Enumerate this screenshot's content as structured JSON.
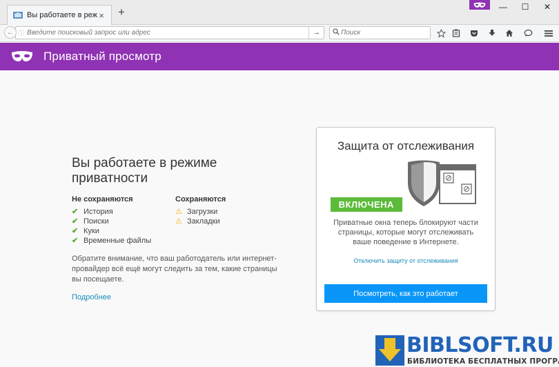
{
  "tab": {
    "title": "Вы работаете в режиме ...",
    "close": "×"
  },
  "newtab": "+",
  "window": {
    "minimize": "—",
    "maximize": "☐",
    "close": "✕"
  },
  "nav": {
    "url_placeholder": "Введите поисковый запрос или адрес",
    "go": "→",
    "search_placeholder": "Поиск"
  },
  "header": {
    "title": "Приватный просмотр"
  },
  "private": {
    "heading": "Вы работаете в режиме приватности",
    "not_saved": {
      "title": "Не сохраняются",
      "items": [
        "История",
        "Поиски",
        "Куки",
        "Временные файлы"
      ]
    },
    "saved": {
      "title": "Сохраняются",
      "items": [
        "Загрузки",
        "Закладки"
      ]
    },
    "note": "Обратите внимание, что ваш работодатель или интернет-провайдер всё ещё могут следить за тем, какие страницы вы посещаете.",
    "more": "Подробнее"
  },
  "tracking": {
    "title": "Защита от отслеживания",
    "status": "ВКЛЮЧЕНА",
    "description": "Приватные окна теперь блокируют части страницы, которые могут отслеживать ваше поведение в Интернете.",
    "disable_link": "Отключить защиту от отслеживания",
    "button": "Посмотреть, как это работает"
  },
  "watermark": {
    "logo": "BIBLSOFT.RU",
    "subtitle": "БИБЛИОТЕКА БЕСПЛАТНЫХ ПРОГРАММ"
  },
  "colors": {
    "private_purple": "#8f32b4",
    "badge_green": "#5cbb3a",
    "button_blue": "#0996f8",
    "link_blue": "#1a8bb8",
    "check_green": "#5ca830",
    "warn_yellow": "#f0b400"
  },
  "icons": [
    "tab-favicon-icon",
    "info-icon",
    "search-icon",
    "star-icon",
    "reading-list-icon",
    "pocket-icon",
    "download-icon",
    "home-icon",
    "chat-icon",
    "menu-icon",
    "mask-icon",
    "check-icon",
    "warning-icon",
    "shield-icon"
  ]
}
